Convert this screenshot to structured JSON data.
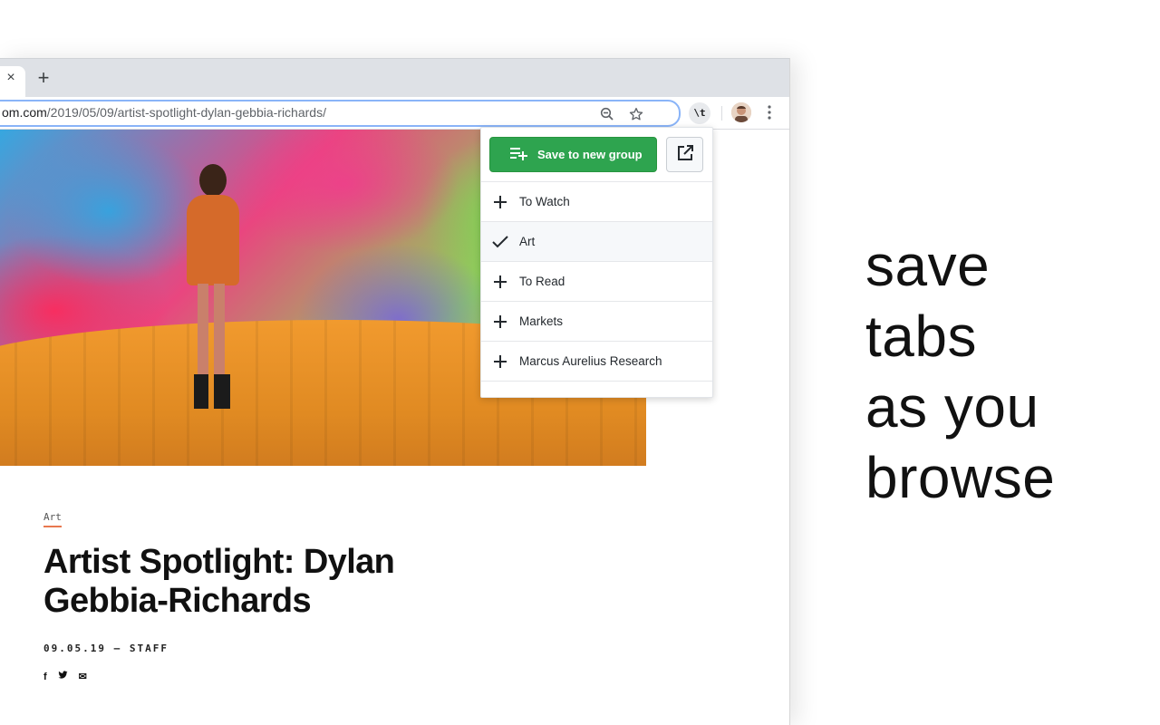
{
  "browser": {
    "tab_close": "×",
    "new_tab": "+",
    "url_host_partial": "om.com",
    "url_path": "/2019/05/09/artist-spotlight-dylan-gebbia-richards/",
    "extension_label": "\\t"
  },
  "popup": {
    "save_button_label": "Save to new group",
    "groups": [
      {
        "label": "To Watch",
        "icon": "plus-icon",
        "selected": false
      },
      {
        "label": "Art",
        "icon": "check-icon",
        "selected": true
      },
      {
        "label": "To Read",
        "icon": "plus-icon",
        "selected": false
      },
      {
        "label": "Markets",
        "icon": "plus-icon",
        "selected": false
      },
      {
        "label": "Marcus Aurelius Research",
        "icon": "plus-icon",
        "selected": false
      }
    ]
  },
  "article": {
    "category": "Art",
    "title": "Artist Spotlight: Dylan Gebbia-Richards",
    "byline": "09.05.19 — STAFF",
    "social": [
      "f",
      "t",
      "✉"
    ]
  },
  "tagline": [
    "save",
    "tabs",
    "as you",
    "browse"
  ],
  "colors": {
    "accent_green": "#2ea44f",
    "omnibox_focus": "#8ab4f8",
    "category_underline": "#e8784f"
  }
}
